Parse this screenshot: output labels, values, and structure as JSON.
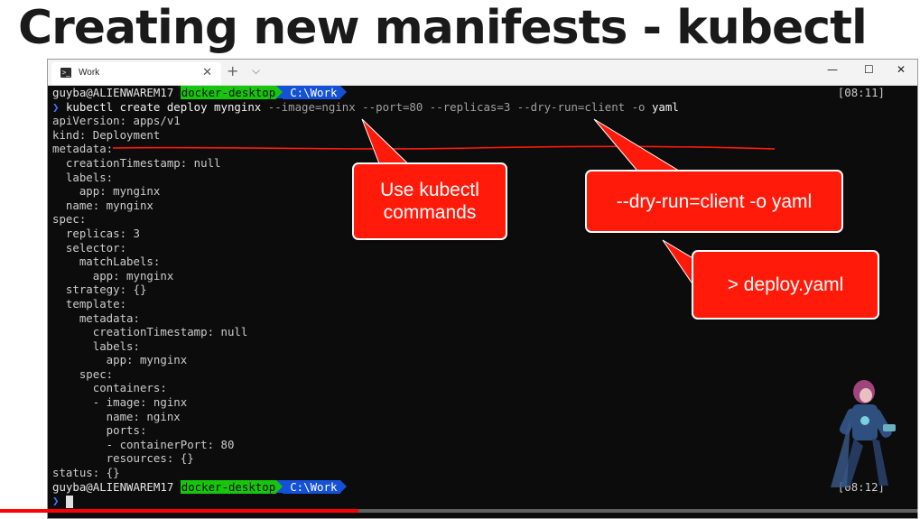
{
  "slide": {
    "title": "Creating new manifests - kubectl"
  },
  "window": {
    "tab_label": "Work",
    "tab_close": "✕",
    "new_tab": "+",
    "dropdown": "⌵",
    "minimize": "—",
    "maximize": "☐",
    "close": "✕"
  },
  "prompt": {
    "user": "guyba@ALIENWAREM17",
    "context": "docker-desktop",
    "path": "C:\\Work",
    "time1": "[08:11]",
    "time2": "[08:12]",
    "chevron": "❯"
  },
  "command": {
    "main": "kubectl create deploy mynginx",
    "args": "--image=nginx --port=80 --replicas=3 --dry-run=client -o",
    "last": "yaml"
  },
  "yaml_lines": [
    "apiVersion: apps/v1",
    "kind: Deployment",
    "metadata:",
    "  creationTimestamp: null",
    "  labels:",
    "    app: mynginx",
    "  name: mynginx",
    "spec:",
    "  replicas: 3",
    "  selector:",
    "    matchLabels:",
    "      app: mynginx",
    "  strategy: {}",
    "  template:",
    "    metadata:",
    "      creationTimestamp: null",
    "      labels:",
    "        app: mynginx",
    "    spec:",
    "      containers:",
    "      - image: nginx",
    "        name: nginx",
    "        ports:",
    "        - containerPort: 80",
    "        resources: {}",
    "status: {}"
  ],
  "callouts": {
    "use_kubectl": "Use kubectl commands",
    "dry_run": "--dry-run=client -o yaml",
    "deploy": "> deploy.yaml"
  },
  "video": {
    "progress": 0.39,
    "accent": "#ff0000"
  }
}
